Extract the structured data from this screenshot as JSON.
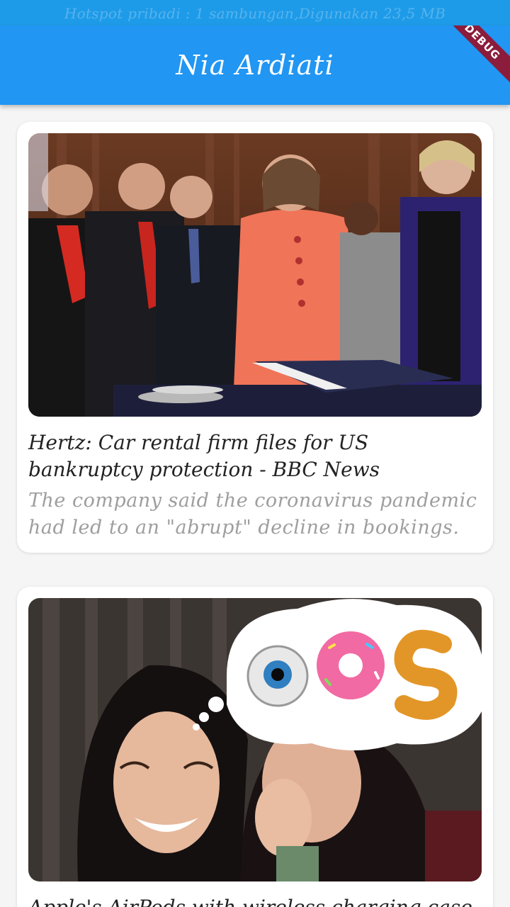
{
  "status_bar": {
    "text": "Hotspot pribadi : 1 sambungan,Digunakan 23,5 MB"
  },
  "app_bar": {
    "title": "Nia Ardiati",
    "debug_label": "DEBUG"
  },
  "articles": [
    {
      "title": "Hertz: Car rental firm files for US bankruptcy protection - BBC News",
      "description": "The company said the coronavirus pandemic had led to an \"abrupt\" decline in bookings.",
      "image": "photo of politicians standing around a table"
    },
    {
      "title": "Apple's AirPods with wireless charging case",
      "description": "",
      "image": "photo of two laughing women with OOS thought bubble"
    }
  ],
  "colors": {
    "status_bar": "#1e9be8",
    "app_bar": "#2196f3",
    "debug_banner": "#8b1c3b"
  }
}
